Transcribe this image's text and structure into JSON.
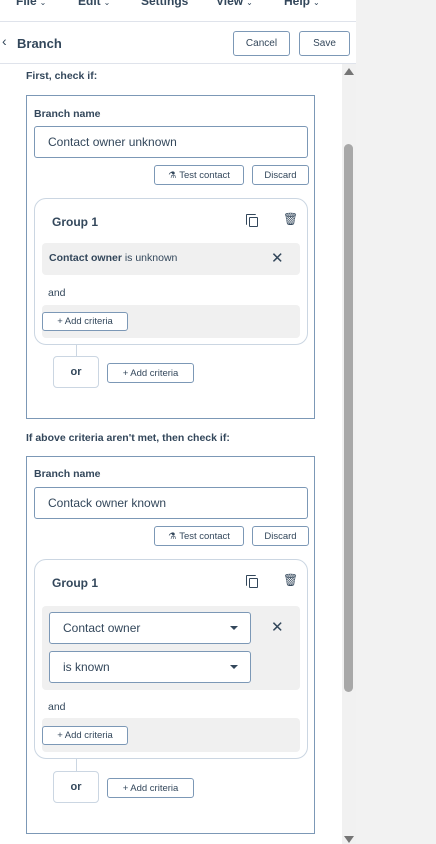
{
  "menubar": {
    "items": [
      {
        "label": "File",
        "chevron": "⌄"
      },
      {
        "label": "Edit",
        "chevron": "⌄"
      },
      {
        "label": "Settings"
      },
      {
        "label": "View",
        "chevron": "⌄"
      },
      {
        "label": "Help",
        "chevron": "⌄"
      }
    ]
  },
  "header": {
    "back_icon": "‹",
    "title": "Branch",
    "cancel_label": "Cancel",
    "save_label": "Save"
  },
  "branches": [
    {
      "section_label": "First, check if:",
      "branch_name_label": "Branch name",
      "branch_name_value": "Contact owner unknown",
      "test_contact_label": "Test contact",
      "discard_label": "Discard",
      "group": {
        "title": "Group 1",
        "criteria": {
          "property": "Contact owner",
          "operator": "is unknown"
        },
        "and_label": "and",
        "add_criteria_label": "Add criteria"
      },
      "or_label": "or",
      "add_criteria_label": "Add criteria"
    },
    {
      "section_label": "If above criteria aren't met, then check if:",
      "branch_name_label": "Branch name",
      "branch_name_value": "Contack owner known",
      "test_contact_label": "Test contact",
      "discard_label": "Discard",
      "group": {
        "title": "Group 1",
        "property_select": "Contact owner",
        "operator_select": "is known",
        "and_label": "and",
        "add_criteria_label": "Add criteria"
      },
      "or_label": "or",
      "add_criteria_label": "Add criteria"
    }
  ],
  "icons": {
    "plus": "+",
    "close": "✕",
    "flask": "⚗",
    "trash": "🗑",
    "copy": "copy-icon"
  },
  "colors": {
    "text": "#33475b",
    "border": "#7c98b6",
    "light_border": "#cbd6e2",
    "criteria_bg": "#f0f0f0"
  }
}
